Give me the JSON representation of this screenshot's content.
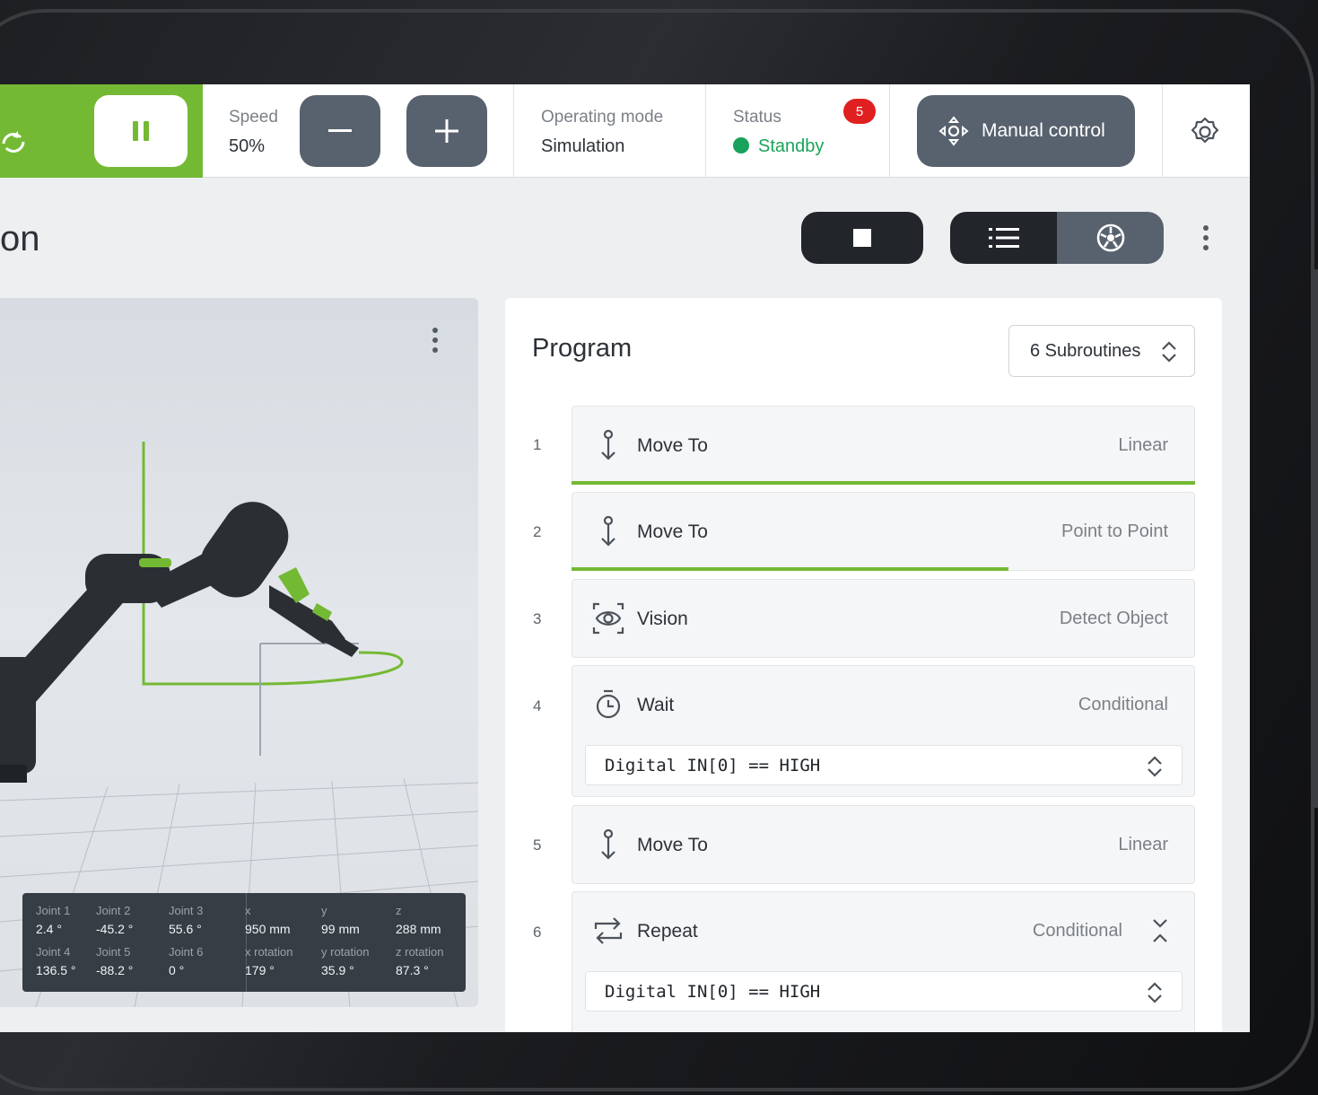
{
  "topbar": {
    "speed_label": "Speed",
    "speed_value": "50%",
    "operating_mode_label": "Operating mode",
    "operating_mode_value": "Simulation",
    "status_label": "Status",
    "status_value": "Standby",
    "status_badge": "5",
    "manual_control_label": "Manual control"
  },
  "page": {
    "title_fragment": "on"
  },
  "readout": [
    {
      "k": "Joint 1",
      "v": "2.4 °"
    },
    {
      "k": "Joint 2",
      "v": "-45.2 °"
    },
    {
      "k": "Joint 3",
      "v": "55.6 °"
    },
    {
      "k": "x",
      "v": "950 mm"
    },
    {
      "k": "y",
      "v": "99 mm"
    },
    {
      "k": "z",
      "v": "288 mm"
    },
    {
      "k": "Joint 4",
      "v": "136.5 °"
    },
    {
      "k": "Joint 5",
      "v": "-88.2 °"
    },
    {
      "k": "Joint 6",
      "v": "0 °"
    },
    {
      "k": "x rotation",
      "v": "179 °"
    },
    {
      "k": "y rotation",
      "v": "35.9 °"
    },
    {
      "k": "z rotation",
      "v": "87.3 °"
    }
  ],
  "program": {
    "title": "Program",
    "subroutines": "6 Subroutines",
    "steps": [
      {
        "num": "1",
        "name": "Move To",
        "type": "Linear",
        "icon": "move-to-icon",
        "progress": 1.0
      },
      {
        "num": "2",
        "name": "Move To",
        "type": "Point to Point",
        "icon": "move-to-icon",
        "progress": 0.7
      },
      {
        "num": "3",
        "name": "Vision",
        "type": "Detect Object",
        "icon": "vision-icon"
      },
      {
        "num": "4",
        "name": "Wait",
        "type": "Conditional",
        "icon": "timer-icon",
        "condition": "Digital IN[0] == HIGH"
      },
      {
        "num": "5",
        "name": "Move To",
        "type": "Linear",
        "icon": "move-to-icon"
      },
      {
        "num": "6",
        "name": "Repeat",
        "type": "Conditional",
        "icon": "repeat-icon",
        "condition": "Digital IN[0] == HIGH"
      }
    ]
  },
  "colors": {
    "accent": "#74b934",
    "button": "#58626e",
    "dark": "#22262b",
    "status": "#19a35a",
    "badge": "#e02020"
  }
}
